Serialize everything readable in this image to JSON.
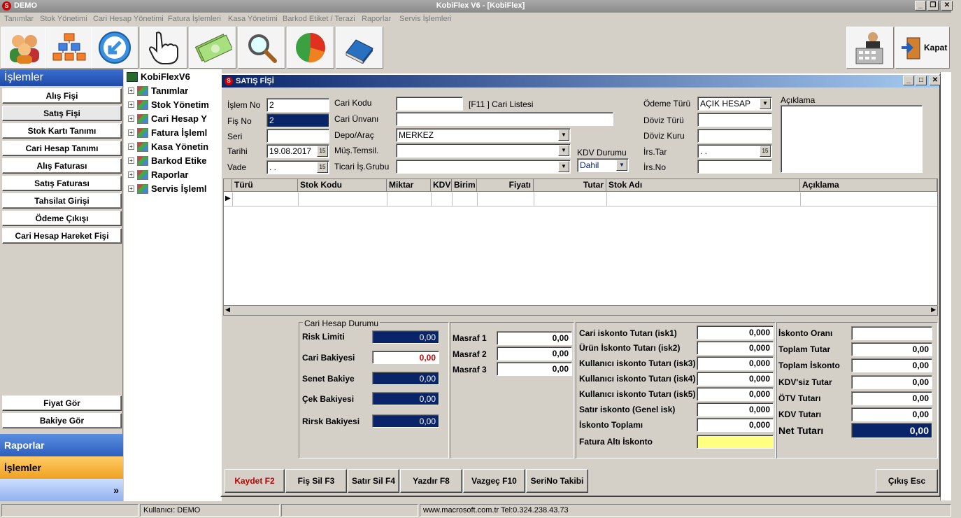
{
  "app": {
    "name": "DEMO",
    "title": "KobiFlex V6 - [KobiFlex]"
  },
  "menu": [
    "Tanımlar",
    "Stok Yönetimi",
    "Cari Hesap Yönetimi",
    "Fatura İşlemleri",
    "Kasa Yönetimi",
    "Barkod Etiket / Terazi",
    "Raporlar",
    "Servis İşlemleri"
  ],
  "toolbar": {
    "close_label": "Kapat"
  },
  "sidebar": {
    "header": "İşlemler",
    "items": [
      "Alış Fişi",
      "Satış Fişi",
      "Stok Kartı Tanımı",
      "Cari Hesap Tanımı",
      "Alış Faturası",
      "Satış Faturası",
      "Tahsilat Girişi",
      "Ödeme Çıkışı",
      "Cari Hesap Hareket Fişi"
    ],
    "bottom_items": [
      "Fiyat Gör",
      "Bakiye Gör"
    ],
    "sections": [
      "Raporlar",
      "İşlemler"
    ]
  },
  "tree": {
    "root": "KobiFlexV6",
    "nodes": [
      "Tanımlar",
      "Stok Yönetim",
      "Cari Hesap Y",
      "Fatura İşleml",
      "Kasa Yönetin",
      "Barkod Etike",
      "Raporlar",
      "Servis İşleml"
    ]
  },
  "form": {
    "title": "SATIŞ FİŞİ",
    "islem_no_label": "İşlem No",
    "islem_no": "2",
    "fis_no_label": "Fiş No",
    "fis_no": "2",
    "seri_label": "Seri",
    "seri": "",
    "tarihi_label": "Tarihi",
    "tarihi": "19.08.2017",
    "vade_label": "Vade",
    "vade": ". .",
    "cari_kodu_label": "Cari Kodu",
    "cari_liste": "[F11 ] Cari Listesi",
    "cari_unvani_label": "Cari Ünvanı",
    "depo_label": "Depo/Araç",
    "depo": "MERKEZ",
    "temsil_label": "Müş.Temsil.",
    "ticari_label": "Ticari İş.Grubu",
    "kdv_durumu_label": "KDV Durumu",
    "kdv_durumu": "Dahil",
    "odeme_turu_label": "Ödeme Türü",
    "odeme_turu": "AÇIK HESAP",
    "doviz_turu_label": "Döviz Türü",
    "doviz_kuru_label": "Döviz Kuru",
    "irs_tar_label": "İrs.Tar",
    "irs_tar": ". .",
    "irs_no_label": "İrs.No",
    "aciklama_label": "Açıklama"
  },
  "grid": {
    "columns": [
      "Türü",
      "Stok Kodu",
      "Miktar",
      "KDV",
      "Birim",
      "Fiyatı",
      "Tutar",
      "Stok Adı",
      "Açıklama"
    ]
  },
  "cari_durum": {
    "title": "Cari Hesap Durumu",
    "risk_limiti_label": "Risk Limiti",
    "risk_limiti": "0,00",
    "cari_bakiye_label": "Cari Bakiyesi",
    "cari_bakiye": "0,00",
    "senet_label": "Senet Bakiye",
    "senet": "0,00",
    "cek_label": "Çek Bakiyesi",
    "cek": "0,00",
    "rirsk_label": "Rirsk Bakiyesi",
    "rirsk": "0,00"
  },
  "masraf": [
    {
      "label": "Masraf 1",
      "value": "0,00"
    },
    {
      "label": "Masraf 2",
      "value": "0,00"
    },
    {
      "label": "Masraf 3",
      "value": "0,00"
    }
  ],
  "iskonto": [
    {
      "label": "Cari iskonto Tutarı    (isk1)",
      "value": "0,000"
    },
    {
      "label": "Ürün İskonto Tutarı      (isk2)",
      "value": "0,000"
    },
    {
      "label": "Kullanıcı iskonto Tutarı (isk3)",
      "value": "0,000"
    },
    {
      "label": "Kullanıcı iskonto Tutarı (isk4)",
      "value": "0,000"
    },
    {
      "label": "Kullanıcı iskonto Tutarı (isk5)",
      "value": "0,000"
    },
    {
      "label": "Satır iskonto  (Genel isk)",
      "value": "0,000"
    },
    {
      "label": "İskonto Toplamı",
      "value": "0,000"
    },
    {
      "label": "Fatura Altı İskonto",
      "value": ""
    }
  ],
  "totals": [
    {
      "label": "İskonto Oranı",
      "value": ""
    },
    {
      "label": "Toplam Tutar",
      "value": "0,00"
    },
    {
      "label": "Toplam İskonto",
      "value": "0,00"
    },
    {
      "label": "KDV'siz Tutar",
      "value": "0,00"
    },
    {
      "label": "ÖTV Tutarı",
      "value": "0,00"
    },
    {
      "label": "KDV Tutarı",
      "value": "0,00"
    },
    {
      "label": "Net Tutarı",
      "value": "0,00"
    }
  ],
  "buttons": {
    "kaydet": "Kaydet F2",
    "fis_sil": "Fiş Sil F3",
    "satir_sil": "Satır Sil F4",
    "yazdir": "Yazdır  F8",
    "vazgec": "Vazgeç F10",
    "serino": "SeriNo Takibi",
    "cikis": "Çıkış Esc"
  },
  "status": {
    "user": "Kullanıcı: DEMO",
    "contact": "www.macrosoft.com.tr  Tel:0.324.238.43.73"
  }
}
